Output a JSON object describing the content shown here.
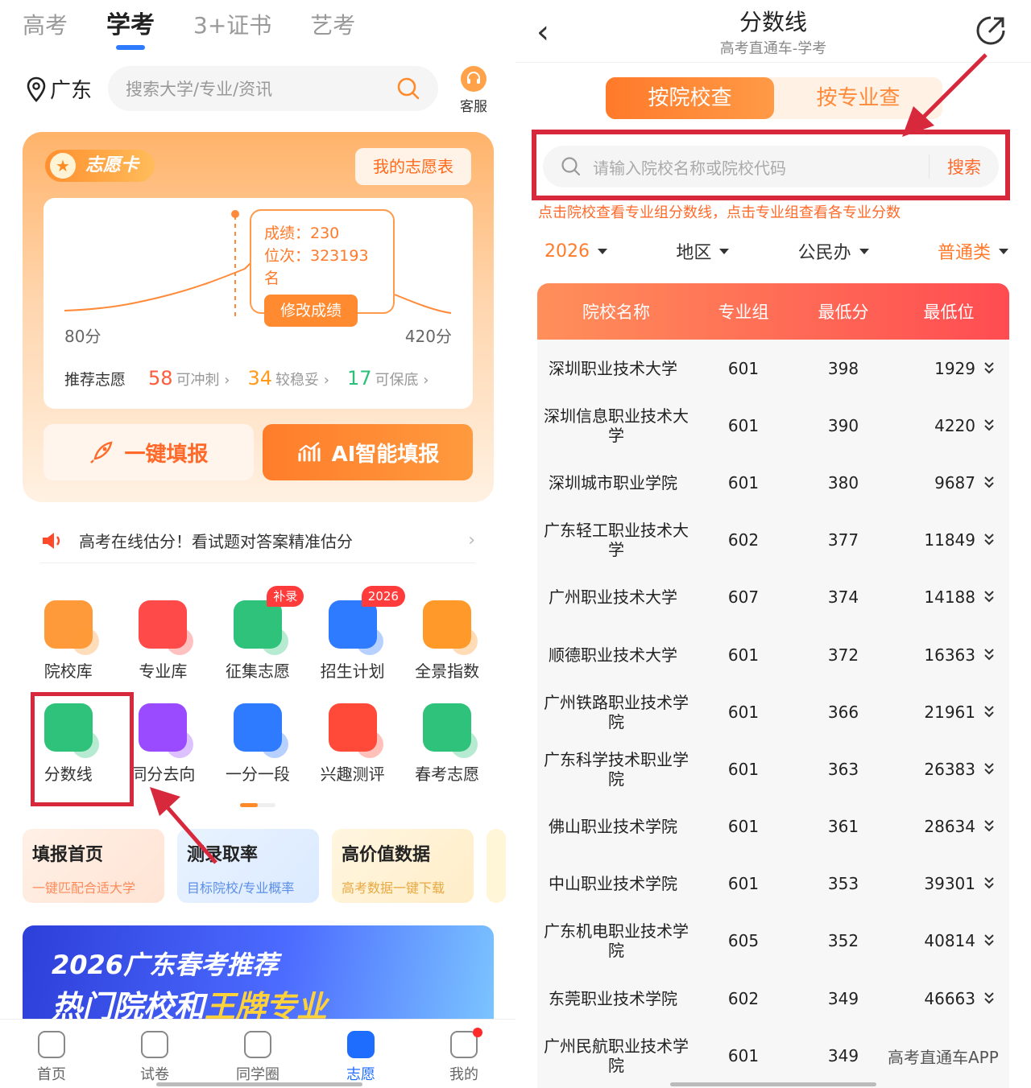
{
  "left": {
    "tabs": [
      "高考",
      "学考",
      "3+证书",
      "艺考"
    ],
    "active_tab": "学考",
    "location": "广东",
    "search_placeholder": "搜索大学/专业/资讯",
    "kefu_label": "客服",
    "wish_card": {
      "badge": "志愿卡",
      "my_table_button": "我的志愿表",
      "score_label": "成绩：230",
      "rank_label": "位次：323193名",
      "edit_button": "修改成绩",
      "axis_min": "80分",
      "axis_max": "420分",
      "recommend_label": "推荐志愿",
      "rec": [
        {
          "num": "58",
          "text": "可冲刺"
        },
        {
          "num": "34",
          "text": "较稳妥"
        },
        {
          "num": "17",
          "text": "可保底"
        }
      ],
      "one_click_button": "一键填报",
      "ai_button": "AI智能填报"
    },
    "notice": "高考在线估分！看试题对答案精准估分",
    "grid": [
      [
        {
          "label": "院校库",
          "icon": "school-icon",
          "color": "#ff9a3a"
        },
        {
          "label": "专业库",
          "icon": "book-icon",
          "color": "#ff4a4a"
        },
        {
          "label": "征集志愿",
          "icon": "search-screen-icon",
          "color": "#2ec27a",
          "badge": "补录"
        },
        {
          "label": "招生计划",
          "icon": "plan-icon",
          "color": "#2f7bff",
          "badge": "2026"
        },
        {
          "label": "全景指数",
          "icon": "index-icon",
          "color": "#ff9a2a"
        }
      ],
      [
        {
          "label": "分数线",
          "icon": "score-line-icon",
          "color": "#2ec27a"
        },
        {
          "label": "同分去向",
          "icon": "same-score-icon",
          "color": "#9a4aff"
        },
        {
          "label": "一分一段",
          "icon": "segment-icon",
          "color": "#2f7bff"
        },
        {
          "label": "兴趣测评",
          "icon": "interest-icon",
          "color": "#ff4a3a"
        },
        {
          "label": "春考志愿",
          "icon": "question-icon",
          "color": "#2ec27a"
        }
      ]
    ],
    "features": [
      {
        "title": "填报首页",
        "sub": "一键匹配合适大学"
      },
      {
        "title": "测录取率",
        "sub": "目标院校/专业概率"
      },
      {
        "title": "高价值数据",
        "sub": "高考数据一键下载"
      }
    ],
    "banner": {
      "line1": "2026广东春考推荐",
      "line2a": "热门院校和",
      "line2b": "王牌专业"
    },
    "bottom_nav": [
      "首页",
      "试卷",
      "同学圈",
      "志愿",
      "我的"
    ],
    "active_nav": "志愿"
  },
  "right": {
    "title": "分数线",
    "subtitle": "高考直通车-学考",
    "segments": [
      "按院校查",
      "按专业查"
    ],
    "search_placeholder": "请输入院校名称或院校代码",
    "search_button": "搜索",
    "hint": "点击院校查看专业组分数线，点击专业组查看各专业分数",
    "filters": [
      "2026",
      "地区",
      "公民办",
      "普通类"
    ],
    "columns": [
      "院校名称",
      "专业组",
      "最低分",
      "最低位"
    ],
    "rows": [
      [
        "深圳职业技术大学",
        "601",
        "398",
        "1929"
      ],
      [
        "深圳信息职业技术大学",
        "601",
        "390",
        "4220"
      ],
      [
        "深圳城市职业学院",
        "601",
        "380",
        "9687"
      ],
      [
        "广东轻工职业技术大学",
        "602",
        "377",
        "11849"
      ],
      [
        "广州职业技术大学",
        "607",
        "374",
        "14188"
      ],
      [
        "顺德职业技术大学",
        "601",
        "372",
        "16363"
      ],
      [
        "广州铁路职业技术学院",
        "601",
        "366",
        "21961"
      ],
      [
        "广东科学技术职业学院",
        "601",
        "363",
        "26383"
      ],
      [
        "佛山职业技术学院",
        "601",
        "361",
        "28634"
      ],
      [
        "中山职业技术学院",
        "601",
        "353",
        "39301"
      ],
      [
        "广东机电职业技术学院",
        "605",
        "352",
        "40814"
      ],
      [
        "东莞职业技术学院",
        "602",
        "349",
        "46663"
      ],
      [
        "广州民航职业技术学院",
        "601",
        "349",
        ""
      ]
    ],
    "watermark": "高考直通车APP"
  }
}
